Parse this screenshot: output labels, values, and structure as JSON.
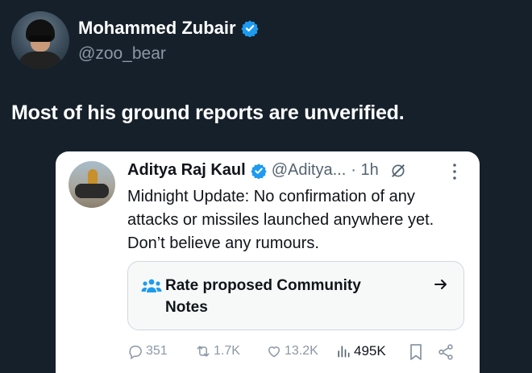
{
  "author": {
    "name": "Mohammed Zubair",
    "handle": "@zoo_bear"
  },
  "tweet": {
    "text": "Most of his ground reports are unverified."
  },
  "quote": {
    "name": "Aditya Raj Kaul",
    "handle": "@Aditya...",
    "time": "· 1h",
    "text": "Midnight Update: No confirmation of any attacks or missiles launched anywhere yet. Don’t believe any rumours.",
    "community_notes_label": "Rate proposed Community Notes",
    "actions": {
      "replies": "351",
      "reposts": "1.7K",
      "likes": "13.2K",
      "views": "495K"
    }
  },
  "colors": {
    "background": "#15202b",
    "verified": "#1d9bf0",
    "card": "#ffffff",
    "muted": "#8b98a5"
  }
}
